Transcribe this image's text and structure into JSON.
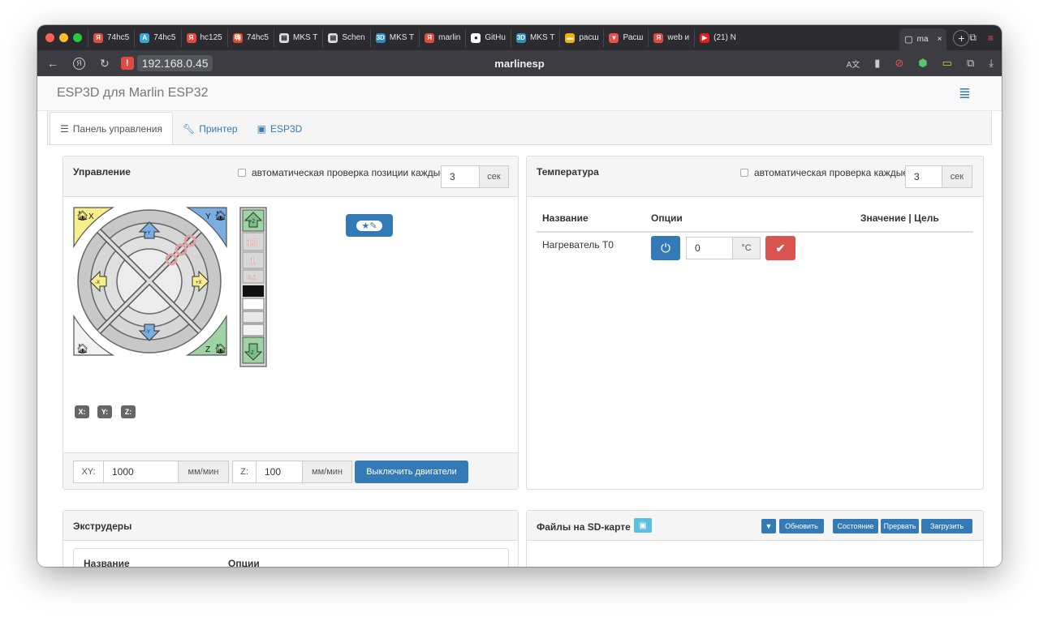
{
  "browser": {
    "tabs": [
      {
        "label": "74hc5",
        "color": "#e04a3f",
        "glyph": "Я"
      },
      {
        "label": "74hc5",
        "color": "#3aa5d8",
        "glyph": "A"
      },
      {
        "label": "hc125",
        "color": "#e04a3f",
        "glyph": "Я"
      },
      {
        "label": "74hc5",
        "color": "#d94d2a",
        "glyph": "嗨"
      },
      {
        "label": "MKS T",
        "color": "#ddd",
        "glyph": "▤"
      },
      {
        "label": "Schen",
        "color": "#ddd",
        "glyph": "▤"
      },
      {
        "label": "MKS T",
        "color": "#2b8fc7",
        "glyph": "3D"
      },
      {
        "label": "marlin",
        "color": "#e04a3f",
        "glyph": "Я"
      },
      {
        "label": "GitHu",
        "color": "#fff",
        "glyph": "●"
      },
      {
        "label": "MKS T",
        "color": "#2b8fc7",
        "glyph": "3D"
      },
      {
        "label": "расш",
        "color": "#f0b400",
        "glyph": "▬"
      },
      {
        "label": "Расш",
        "color": "#e8514b",
        "glyph": "▾"
      },
      {
        "label": "web и",
        "color": "#e04a3f",
        "glyph": "Я"
      },
      {
        "label": "(21) N",
        "color": "#e02020",
        "glyph": "▶"
      }
    ],
    "active_tab": "ma",
    "address": "192.168.0.45",
    "page_host": "marlinesp"
  },
  "app": {
    "brand": "ESP3D для Marlin ESP32",
    "tabs": [
      "Панель управления",
      "Принтер",
      "ESP3D"
    ]
  },
  "control": {
    "title": "Управление",
    "autocheck_label": "автоматическая проверка позиции каждые:",
    "interval": "3",
    "interval_unit": "сек",
    "jog": {
      "home_x": "X",
      "home_y": "Y",
      "home_z": "Z",
      "plus_y": "+Y",
      "minus_y": "-Y",
      "plus_x": "+X",
      "minus_x": "-X",
      "plus_z": "+Z",
      "minus_z": "-Z",
      "steps": [
        "10",
        "1",
        "0.1"
      ]
    },
    "macro_icon": "star-pencil-icon",
    "positions": [
      "X:",
      "Y:",
      "Z:"
    ],
    "xy_label": "XY:",
    "xy_value": "1000",
    "xy_unit": "мм/мин",
    "z_label": "Z:",
    "z_value": "100",
    "z_unit": "мм/мин",
    "motors_off": "Выключить двигатели"
  },
  "temperature": {
    "title": "Температура",
    "autocheck_label": "автоматическая проверка каждые:",
    "interval": "3",
    "interval_unit": "сек",
    "col_name": "Название",
    "col_options": "Опции",
    "col_value": "Значение | Цель",
    "heater_label": "Нагреватель T0",
    "heater_value": "0",
    "heater_unit": "°C"
  },
  "extruders": {
    "title": "Экструдеры",
    "col_name": "Название",
    "col_options": "Опции"
  },
  "sd": {
    "title": "Файлы на SD-карте",
    "filter_icon": "filter-icon",
    "btn_refresh": "Обновить",
    "btn_status": "Состояние",
    "btn_abort": "Прервать",
    "btn_upload": "Загрузить"
  }
}
